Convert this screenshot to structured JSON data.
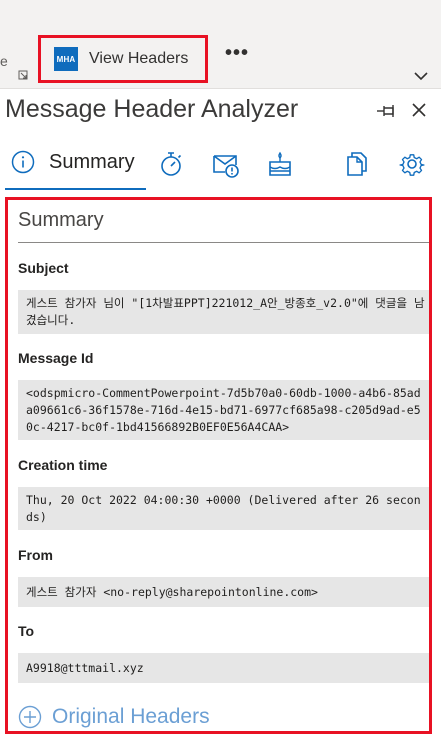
{
  "ribbon": {
    "edge_text": "e",
    "view_headers_label": "View Headers",
    "logo_text": "MHA",
    "more_label": "•••"
  },
  "pane": {
    "title": "Message Header Analyzer"
  },
  "tabs": {
    "summary_label": "Summary",
    "icons": [
      "info-icon",
      "stopwatch-icon",
      "mail-warning-icon",
      "cake-icon",
      "copy-icon",
      "gear-icon"
    ]
  },
  "summary": {
    "title": "Summary",
    "fields": [
      {
        "label": "Subject",
        "value": "게스트 참가자 님이 \"[1차발표PPT]221012_A안_방종호_v2.0\"에 댓글을 남겼습니다."
      },
      {
        "label": "Message Id",
        "value": "<odspmicro-CommentPowerpoint-7d5b70a0-60db-1000-a4b6-85ada09661c6-36f1578e-716d-4e15-bd71-6977cf685a98-c205d9ad-e50c-4217-bc0f-1bd41566892B0EF0E56A4CAA>"
      },
      {
        "label": "Creation time",
        "value": "Thu, 20 Oct 2022 04:00:30 +0000 (Delivered after 26 seconds)"
      },
      {
        "label": "From",
        "value": "게스트 참가자 <no-reply@sharepointonline.com>"
      },
      {
        "label": "To",
        "value": "A9918@tttmail.xyz"
      }
    ],
    "original_headers_label": "Original Headers"
  },
  "colors": {
    "accent": "#0f6cbd",
    "highlight": "#e81123",
    "field_bg": "#e6e6e6"
  }
}
